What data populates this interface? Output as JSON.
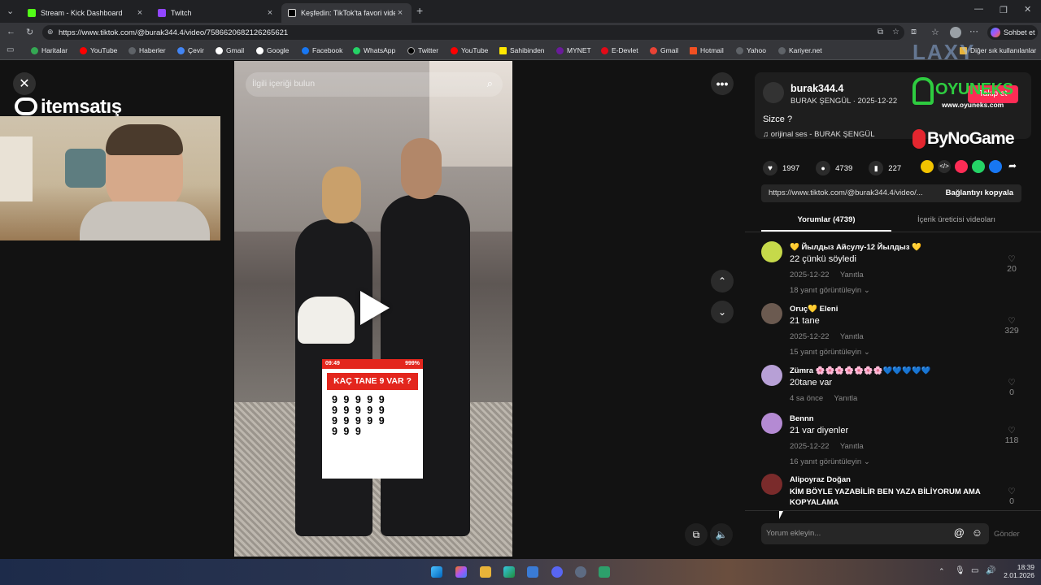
{
  "browser": {
    "tabs": [
      {
        "label": "Stream - Kick Dashboard",
        "color": "#53fc18"
      },
      {
        "label": "Twitch",
        "color": "#9146ff"
      },
      {
        "label": "Keşfedin: TikTok'ta favori videoların",
        "color": "#ffffff"
      }
    ],
    "url": "https://www.tiktok.com/@burak344.4/video/7586620682126265621",
    "profile_button": "Sohbet et",
    "bookmarks": [
      "Haritalar",
      "YouTube",
      "Haberler",
      "Çevir",
      "Gmail",
      "Google",
      "Facebook",
      "WhatsApp",
      "Twitter",
      "YouTube",
      "Sahibinden",
      "MYNET",
      "E-Devlet",
      "Gmail",
      "Hotmail",
      "Yahoo",
      "Kariyer.net"
    ],
    "other_bookmarks": "Diğer sık kullanılanlar"
  },
  "overlay": {
    "sponsor_itemsatis": "itemsatış",
    "sponsor_oyuneks": "OYUNEKS",
    "sponsor_oyuneks_url": "www.oyuneks.com",
    "sponsor_bynogame": "ByNoGame",
    "watermark": "LAXY"
  },
  "video": {
    "search_placeholder": "İlgili içeriği bulun",
    "sticker_time": "09:49",
    "sticker_battery": "999%",
    "sticker_title": "KAÇ TANE 9 VAR ?",
    "nines": "9 9 9 9 9 9 9 9 9 9 9 9 9 9 9 9 9 9"
  },
  "post": {
    "username": "burak344.4",
    "subtitle": "BURAK ŞENGÜL · 2025-12-22",
    "follow_label": "Takip et",
    "caption": "Sizce ?",
    "sound": "orijinal ses - BURAK ŞENGÜL",
    "likes": "1997",
    "comments": "4739",
    "saves": "227",
    "link": "https://www.tiktok.com/@burak344.4/video/...",
    "copy_link": "Bağlantıyı kopyala",
    "tab_comments": "Yorumlar (4739)",
    "tab_creator": "İçerik üreticisi videoları"
  },
  "comments": [
    {
      "name": "💛 Йылдыз Айсулу-12 Йылдыз 💛",
      "text": "22 çünkü söyledi",
      "date": "2025-12-22",
      "reply": "Yanıtla",
      "replies": "18 yanıt görüntüleyin",
      "likes": "20"
    },
    {
      "name": "Oruç💛 Eleni",
      "text": "21 tane",
      "date": "2025-12-22",
      "reply": "Yanıtla",
      "replies": "15 yanıt görüntüleyin",
      "likes": "329"
    },
    {
      "name": "Zümra 🌸🌸🌸🌸🌸🌸🌸💙💙💙💙💙",
      "text": "20tane var",
      "date": "4 sa önce",
      "reply": "Yanıtla",
      "replies": "",
      "likes": "0"
    },
    {
      "name": "Bennn",
      "text": "21 var diyenler",
      "date": "2025-12-22",
      "reply": "Yanıtla",
      "replies": "16 yanıt görüntüleyin",
      "likes": "118"
    },
    {
      "name": "Alipoyraz Doğan",
      "text": "KİM BÖYLE YAZABİLİR BEN YAZA BİLİYORUM AMA KOPYALAMA",
      "date": "",
      "reply": "",
      "replies": "",
      "likes": "0"
    }
  ],
  "comment_input": {
    "placeholder": "Yorum ekleyin...",
    "send": "Gönder"
  },
  "taskbar": {
    "time": "18:39",
    "date": "2.01.2026"
  }
}
